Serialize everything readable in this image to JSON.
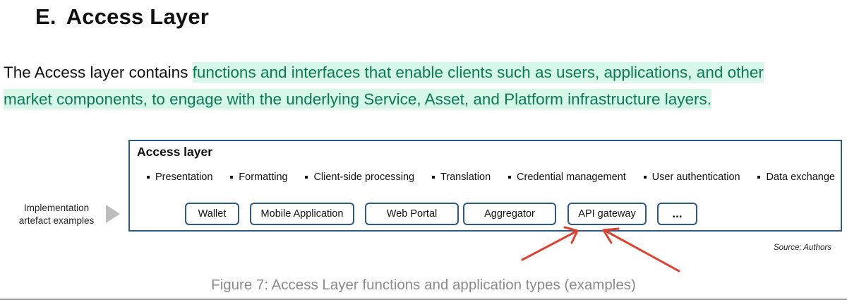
{
  "section": {
    "number": "E.",
    "title": "Access Layer"
  },
  "paragraph": {
    "plain": "The Access layer contains ",
    "highlight_line1": "functions and interfaces that enable clients such as users, applications, and other",
    "highlight_line2": "market components, to engage with the underlying Service, Asset, and Platform infrastructure layers."
  },
  "figure": {
    "box_title": "Access layer",
    "functions": [
      "Presentation",
      "Formatting",
      "Client-side processing",
      "Translation",
      "Credential management",
      "User authentication",
      "Data exchange"
    ],
    "side_label_line1": "Implementation",
    "side_label_line2": "artefact examples",
    "apps": [
      "Wallet",
      "Mobile Application",
      "Web Portal",
      "Aggregator",
      "API gateway",
      "..."
    ],
    "source": "Source: Authors",
    "caption": "Figure 7: Access Layer functions and application types (examples)"
  },
  "colors": {
    "box_border": "#2d5a85",
    "highlight_bg": "#d6f7e8",
    "highlight_text": "#0a7a55",
    "annotation_arrow": "#e0412f",
    "caption_text": "#8a8a8a"
  }
}
